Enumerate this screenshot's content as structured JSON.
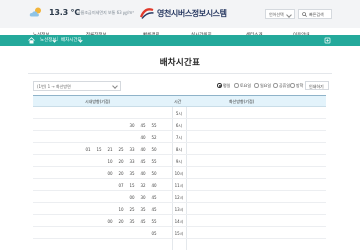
{
  "header": {
    "temperature": "13.3 °C",
    "sky": "구름조금",
    "dust": "미세먼지 보통 63 ㎍/m³",
    "logo_text": "영천시버스정보시스템",
    "language": "언어선택",
    "search_label": "빠른검색"
  },
  "nav": [
    "노선정보",
    "정류장정보",
    "빠른경로",
    "실시간위치",
    "센터소개",
    "이용안내"
  ],
  "breadcrumb": [
    "노선정보",
    "배차시간표"
  ],
  "page_title": "배차시간표",
  "controls": {
    "route_select": "(1번) 1 → 화산방면",
    "radios": [
      {
        "label": "평일",
        "checked": true
      },
      {
        "label": "토요일",
        "checked": false
      },
      {
        "label": "일요일",
        "checked": false
      },
      {
        "label": "공휴일",
        "checked": false
      },
      {
        "label": "방학",
        "checked": false
      }
    ],
    "print_label": "인쇄하기"
  },
  "table": {
    "col_left": "시내방향(기점)",
    "col_hour": "시간",
    "col_right": "화산방향(기점)",
    "rows": [
      {
        "hour": "5시",
        "minutes": []
      },
      {
        "hour": "6시",
        "minutes": [
          "30",
          "45",
          "55"
        ]
      },
      {
        "hour": "7시",
        "minutes": [
          "40",
          "52"
        ]
      },
      {
        "hour": "8시",
        "minutes": [
          "01",
          "15",
          "21",
          "25",
          "33",
          "40",
          "50"
        ]
      },
      {
        "hour": "9시",
        "minutes": [
          "10",
          "20",
          "33",
          "45",
          "55"
        ]
      },
      {
        "hour": "10시",
        "minutes": [
          "00",
          "20",
          "35",
          "40",
          "50"
        ]
      },
      {
        "hour": "11시",
        "minutes": [
          "07",
          "15",
          "32",
          "40"
        ]
      },
      {
        "hour": "12시",
        "minutes": [
          "00",
          "30",
          "45"
        ]
      },
      {
        "hour": "13시",
        "minutes": [
          "10",
          "25",
          "35",
          "45"
        ]
      },
      {
        "hour": "14시",
        "minutes": [
          "00",
          "20",
          "35",
          "45",
          "55"
        ]
      },
      {
        "hour": "15시",
        "minutes": [
          "05"
        ]
      }
    ]
  }
}
